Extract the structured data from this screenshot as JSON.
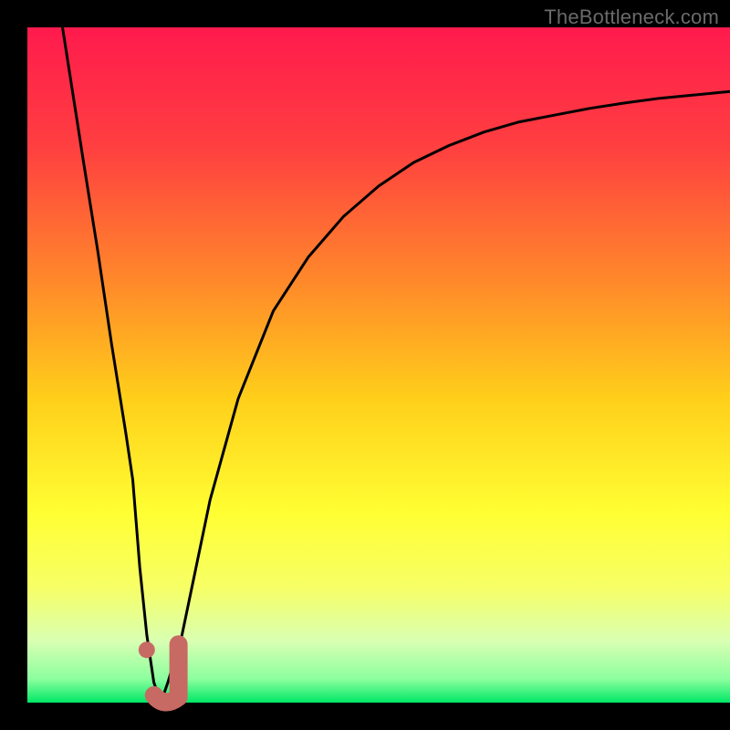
{
  "watermark": "TheBottleneck.com",
  "colors": {
    "black": "#000000",
    "curve": "#000000",
    "marker": "#c76a63",
    "gradient_stops": [
      {
        "offset": 0.0,
        "color": "#ff1a4d"
      },
      {
        "offset": 0.18,
        "color": "#ff4040"
      },
      {
        "offset": 0.38,
        "color": "#ff8a2a"
      },
      {
        "offset": 0.55,
        "color": "#ffcf1a"
      },
      {
        "offset": 0.72,
        "color": "#ffff33"
      },
      {
        "offset": 0.83,
        "color": "#f7ff66"
      },
      {
        "offset": 0.91,
        "color": "#d8ffb3"
      },
      {
        "offset": 0.965,
        "color": "#8cff9e"
      },
      {
        "offset": 1.0,
        "color": "#00e866"
      }
    ]
  },
  "chart_data": {
    "type": "line",
    "title": "",
    "xlabel": "",
    "ylabel": "",
    "xlim": [
      0,
      100
    ],
    "ylim": [
      0,
      100
    ],
    "annotations": [
      "TheBottleneck.com"
    ],
    "series": [
      {
        "name": "bottleneck-curve",
        "x": [
          5,
          8,
          10,
          12,
          14,
          15,
          16,
          17,
          18,
          19,
          20,
          22,
          24,
          26,
          30,
          35,
          40,
          45,
          50,
          55,
          60,
          65,
          70,
          75,
          80,
          85,
          90,
          95,
          100
        ],
        "y": [
          100,
          80,
          67,
          53,
          40,
          33,
          20,
          10,
          3,
          0,
          3,
          10,
          20,
          30,
          45,
          58,
          66,
          72,
          76.5,
          80,
          82.5,
          84.5,
          86,
          87,
          88,
          88.8,
          89.5,
          90,
          90.5
        ]
      }
    ],
    "marker": {
      "name": "optimal-region",
      "shape": "J",
      "x_range": [
        17.5,
        21.5
      ],
      "y_range": [
        0,
        7
      ]
    },
    "legend": null,
    "grid": false
  }
}
